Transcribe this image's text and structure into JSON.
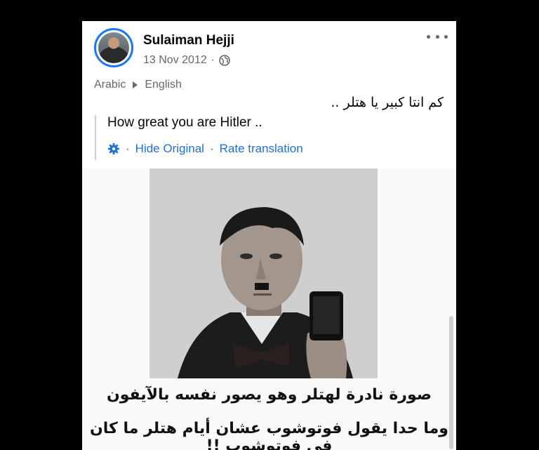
{
  "post": {
    "author": "Sulaiman Hejji",
    "date": "13 Nov 2012",
    "date_separator": "·",
    "globe_icon": "globe-icon",
    "more_icon": "more-horizontal-icon"
  },
  "translation": {
    "source_lang": "Arabic",
    "target_lang": "English",
    "original_text": "كم انتا كبير يا هتلر ..",
    "translated_text": "How great you are Hitler ..",
    "settings_icon": "gear-icon",
    "separator": "·",
    "hide_original_label": "Hide Original",
    "rate_translation_label": "Rate translation",
    "link_color": "#216fdb"
  },
  "image": {
    "caption_line_1": "صورة نادرة لهتلر وهو يصور نفسه بالآيفون",
    "caption_line_2": "وما حدا يقول فوتوشوب عشان أيام هتلر ما كان في فوتوشوب !!"
  }
}
